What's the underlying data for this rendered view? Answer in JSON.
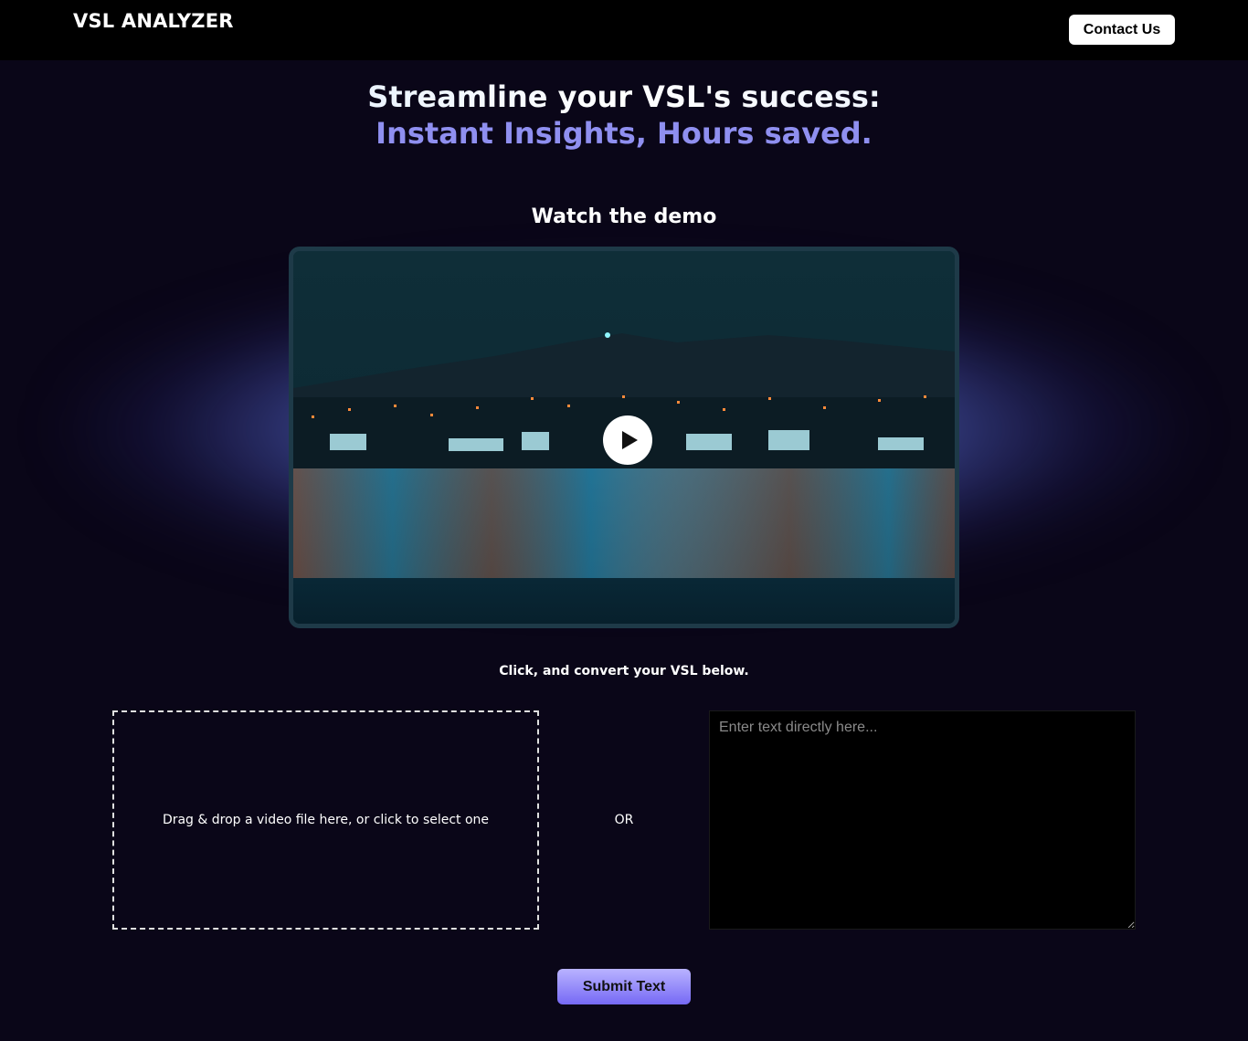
{
  "header": {
    "logo": "VSL ANALYZER",
    "contact_label": "Contact Us"
  },
  "hero": {
    "line1": "Streamline your VSL's success:",
    "line2": "Instant Insights, Hours saved."
  },
  "demo": {
    "title": "Watch the demo",
    "play_icon": "play-icon"
  },
  "convert": {
    "instruction": "Click, and convert your VSL below.",
    "dropzone_text": "Drag & drop a video file here, or click to select one",
    "or_label": "OR",
    "text_placeholder": "Enter text directly here...",
    "submit_label": "Submit Text"
  },
  "colors": {
    "page_bg": "#0a0618",
    "nav_bg": "#000000",
    "accent": "#8f8ff0",
    "submit_gradient_top": "#b9b3ff",
    "submit_gradient_bottom": "#7669f5"
  }
}
